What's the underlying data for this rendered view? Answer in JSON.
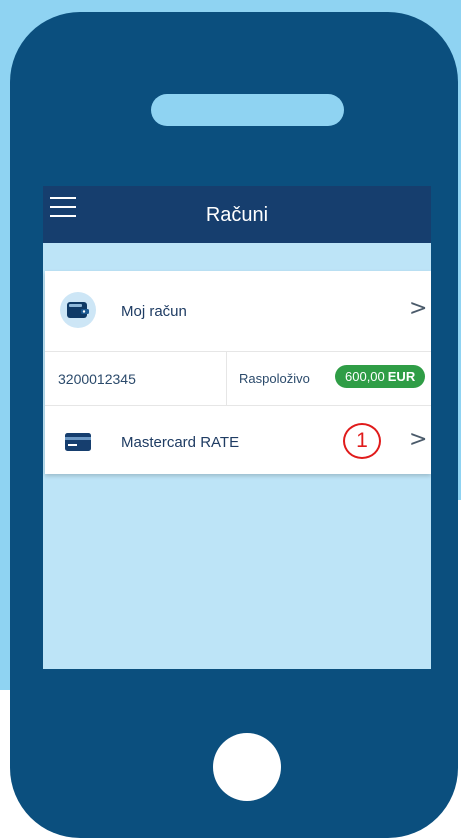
{
  "colors": {
    "frame": "#0b4f7e",
    "light_blue": "#8fd3f2",
    "app_bar": "#163e6e",
    "screen_bg": "#bde4f7",
    "pill_green": "#2f9d46",
    "annotation_red": "#e01b1b"
  },
  "app_bar": {
    "title": "Računi",
    "menu_icon": "hamburger-menu-icon"
  },
  "account": {
    "icon": "wallet-icon",
    "label": "Moj račun",
    "chevron": ">",
    "number": "3200012345",
    "available_label": "Raspoloživo",
    "available_amount": "600,00",
    "currency": "EUR"
  },
  "card": {
    "icon": "credit-card-icon",
    "label": "Mastercard RATE",
    "step_marker": "1",
    "chevron": ">"
  }
}
